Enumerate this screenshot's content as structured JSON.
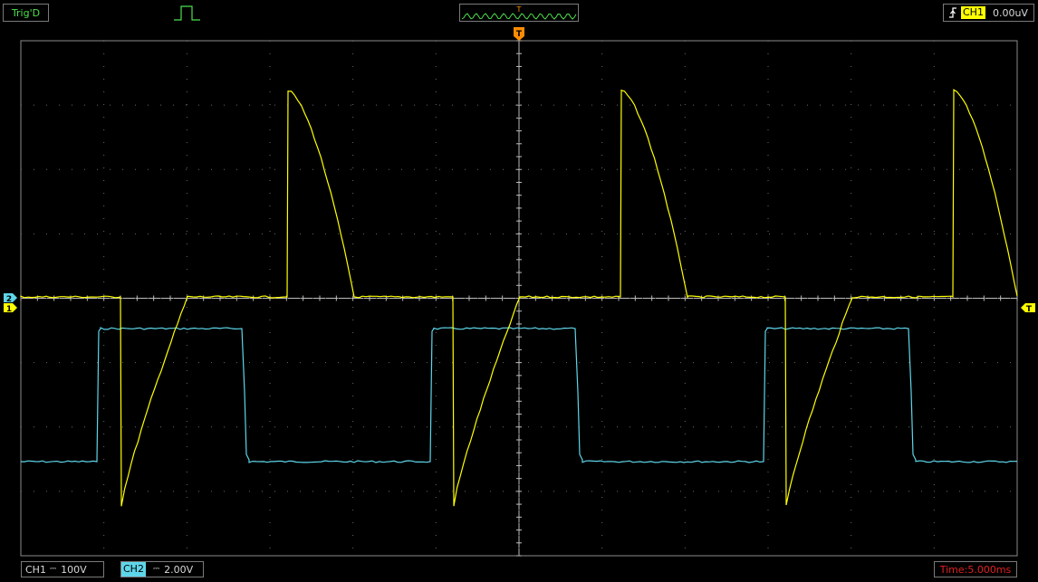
{
  "header": {
    "trigger_status": "Trig'D",
    "trigger_marker": "T",
    "trigger_channel": "CH1",
    "trigger_level": "0.00uV"
  },
  "footer": {
    "ch1_label": "CH1",
    "ch1_coupling": "⎓",
    "ch1_scale": "100V",
    "ch2_label": "CH2",
    "ch2_coupling": "⎓",
    "ch2_scale": "2.00V",
    "timebase": "Time:5.000ms"
  },
  "markers": {
    "trigger_position": "T",
    "trigger_level_marker": "T",
    "ch2_ground": "2",
    "ch1_ground": "1"
  },
  "colors": {
    "ch1": "#ffff00",
    "ch2": "#5ed6ea",
    "trigger_marker": "#ff8c00",
    "grid": "#7a7a7a",
    "status_green": "#4ce04c",
    "time_red": "#e02020"
  }
}
